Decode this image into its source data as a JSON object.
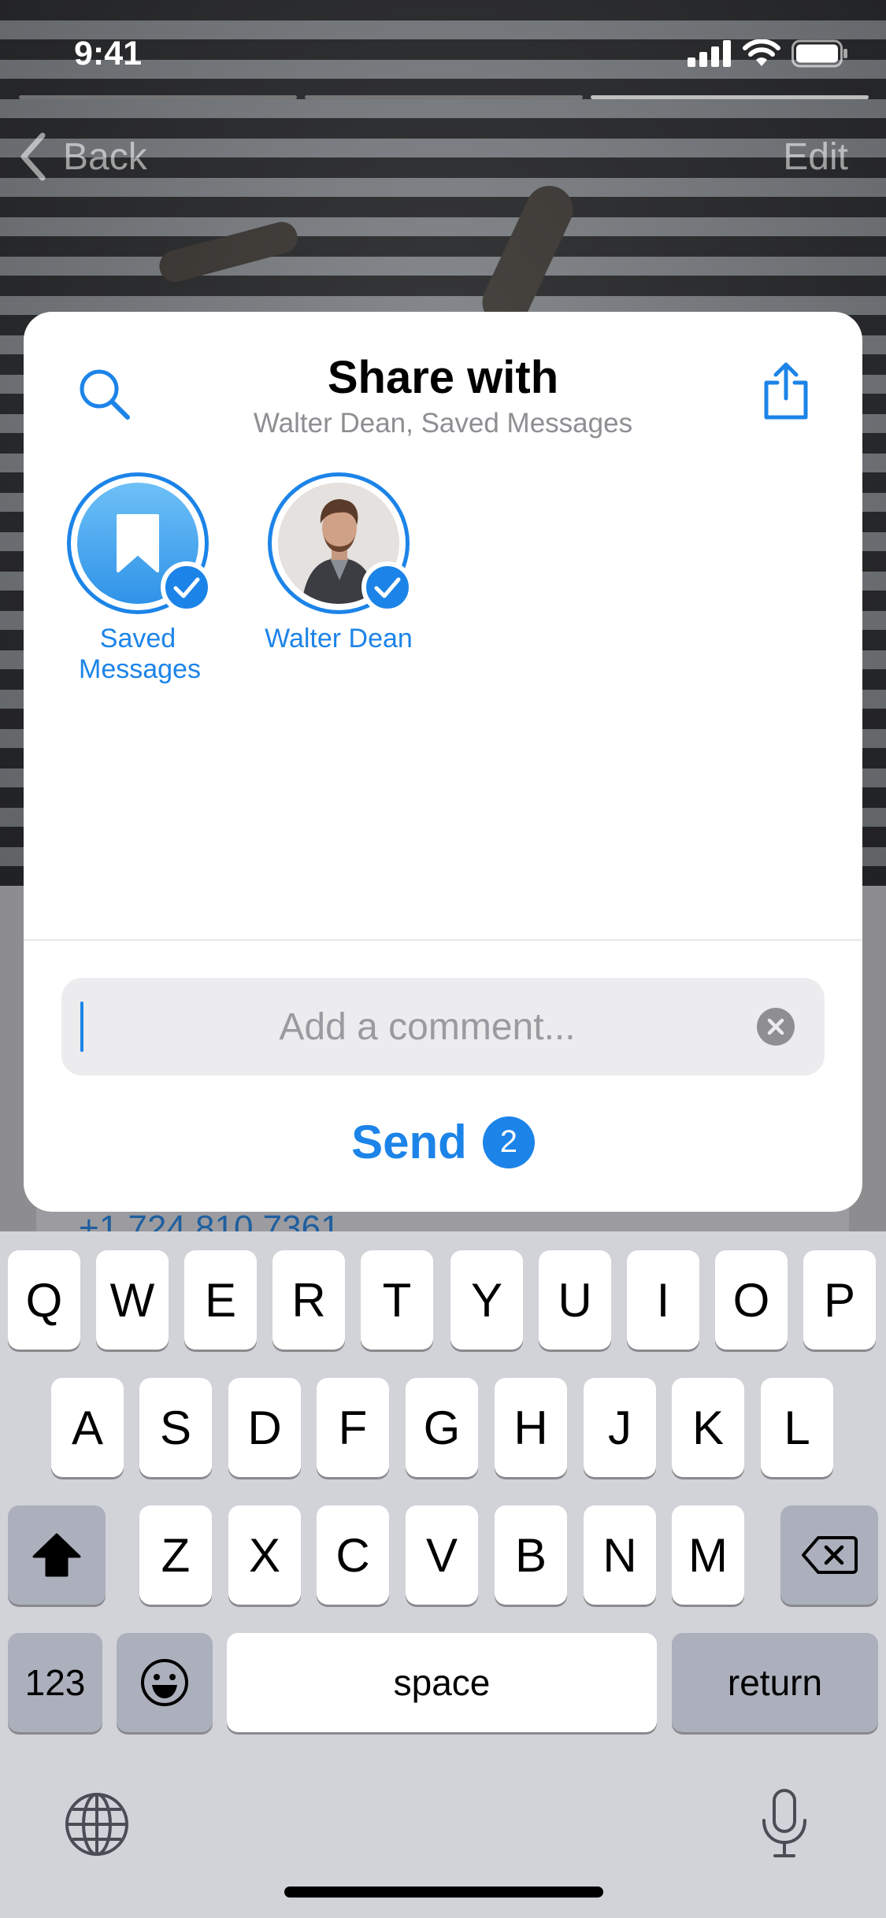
{
  "status_bar": {
    "time": "9:41"
  },
  "nav": {
    "back_label": "Back",
    "edit_label": "Edit"
  },
  "background": {
    "phone_number": "+1 724 810 7361"
  },
  "share_sheet": {
    "title": "Share with",
    "subtitle": "Walter Dean, Saved Messages",
    "recipients": [
      {
        "name": "Saved Messages",
        "selected": true
      },
      {
        "name": "Walter Dean",
        "selected": true
      }
    ],
    "comment_placeholder": "Add a comment...",
    "send_label": "Send",
    "send_count": "2"
  },
  "keyboard": {
    "row1": [
      "Q",
      "W",
      "E",
      "R",
      "T",
      "Y",
      "U",
      "I",
      "O",
      "P"
    ],
    "row2": [
      "A",
      "S",
      "D",
      "F",
      "G",
      "H",
      "J",
      "K",
      "L"
    ],
    "row3": [
      "Z",
      "X",
      "C",
      "V",
      "B",
      "N",
      "M"
    ],
    "numbers_label": "123",
    "space_label": "space",
    "return_label": "return"
  },
  "colors": {
    "accent": "#1c84e8",
    "keyboard_bg": "#d1d3d9"
  }
}
